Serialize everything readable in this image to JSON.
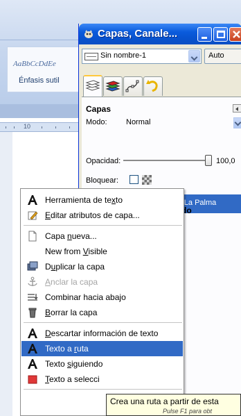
{
  "background_app": {
    "style_sample": "AaBbCcDdEe",
    "style_name": "Énfasis sutil",
    "ruler_number": "10"
  },
  "layers_dock": {
    "title": "Capas, Canale...",
    "image_name": "Sin nombre-1",
    "auto_label": "Auto",
    "panel_heading": "Capas",
    "mode_label": "Modo:",
    "mode_value": "Normal",
    "opacity_label": "Opacidad:",
    "opacity_value": "100,0",
    "opacity_percent": 100,
    "lock_label": "Bloquear:",
    "layer_name": "IES La Palma",
    "hidden_fragment": "do",
    "colors": {
      "title_bar": "#0a5bdc",
      "selection": "#316ac5",
      "dock_bg": "#ece9d8"
    }
  },
  "context_menu": {
    "items": [
      {
        "label_parts": [
          "Herramienta de te",
          "x",
          "to"
        ],
        "icon": "text-tool-icon",
        "disabled": false
      },
      {
        "label_parts": [
          "",
          "E",
          "ditar atributos de capa..."
        ],
        "icon": "edit-attributes-icon",
        "disabled": false
      },
      {
        "label_parts": [
          "Capa ",
          "n",
          "ueva..."
        ],
        "icon": "new-layer-icon",
        "disabled": false
      },
      {
        "label_parts": [
          "New from ",
          "V",
          "isible"
        ],
        "icon": "",
        "disabled": false
      },
      {
        "label_parts": [
          "D",
          "u",
          "plicar la capa"
        ],
        "icon": "duplicate-layer-icon",
        "disabled": false
      },
      {
        "label_parts": [
          "",
          "A",
          "nclar la capa"
        ],
        "icon": "anchor-icon",
        "disabled": true
      },
      {
        "label_parts": [
          "Combinar hacia abajo",
          "",
          ""
        ],
        "icon": "merge-down-icon",
        "disabled": false
      },
      {
        "label_parts": [
          "",
          "B",
          "orrar la capa"
        ],
        "icon": "delete-layer-icon",
        "disabled": false
      },
      {
        "label_parts": [
          "",
          "D",
          "escartar información de texto"
        ],
        "icon": "text-tool-icon",
        "disabled": false
      },
      {
        "label_parts": [
          "Texto a ",
          "r",
          "uta"
        ],
        "icon": "text-tool-icon",
        "disabled": false,
        "highlighted": true
      },
      {
        "label_parts": [
          "Texto ",
          "s",
          "iguiendo"
        ],
        "icon": "text-tool-icon",
        "disabled": false
      },
      {
        "label_parts": [
          "",
          "T",
          "exto a selecci"
        ],
        "icon": "text-to-selection-icon",
        "disabled": false
      }
    ]
  },
  "tooltip": {
    "text": "Crea una ruta a partir de esta",
    "hint": "Pulse F1 para obt"
  }
}
